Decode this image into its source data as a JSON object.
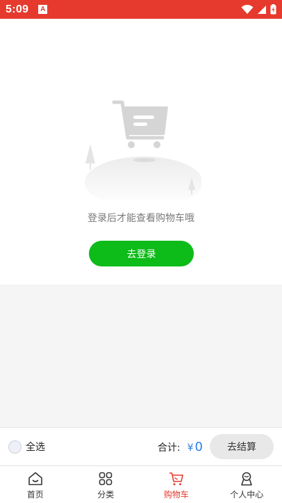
{
  "status_bar": {
    "time": "5:09",
    "app_icon_letter": "A",
    "bg_color": "#e53a2d"
  },
  "empty_state": {
    "message": "登录后才能查看购物车哦",
    "login_button": "去登录",
    "button_color": "#0dbb19"
  },
  "checkout": {
    "select_all": "全选",
    "total_label": "合计:",
    "currency": "¥",
    "total_value": "0",
    "checkout_button": "去结算"
  },
  "tabbar": {
    "active_color": "#e53a2d",
    "items": [
      {
        "label": "首页",
        "icon": "home-icon"
      },
      {
        "label": "分类",
        "icon": "category-grid-icon"
      },
      {
        "label": "购物车",
        "icon": "cart-icon"
      },
      {
        "label": "个人中心",
        "icon": "user-icon"
      }
    ]
  }
}
